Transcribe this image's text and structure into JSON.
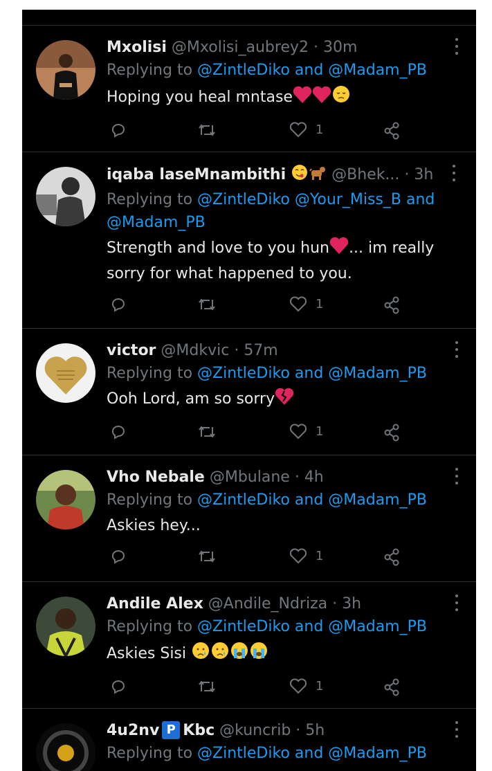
{
  "tweets": [
    {
      "name": "Mxolisi",
      "handle": "@Mxolisi_aubrey2",
      "time": "30m",
      "replying_prefix": "Replying to ",
      "replying_mentions": "@ZintleDiko and @Madam_PB",
      "text": "Hoping you heal mntase",
      "likes": "1"
    },
    {
      "name": "iqaba laseMnambithi",
      "handle": "@Bhek...",
      "time": "3h",
      "replying_prefix": "Replying to ",
      "replying_line1": "@ZintleDiko @Your_Miss_B and",
      "replying_line2": "@Madam_PB",
      "text_a": "Strength and love to you hun",
      "text_b": "... im really sorry for what happened to you.",
      "likes": "1"
    },
    {
      "name": "victor",
      "handle": "@Mdkvic",
      "time": "57m",
      "replying_prefix": "Replying to ",
      "replying_mentions": "@ZintleDiko and @Madam_PB",
      "text": "Ooh Lord, am so sorry",
      "likes": "1"
    },
    {
      "name": "Vho Nebale",
      "handle": "@Mbulane",
      "time": "4h",
      "replying_prefix": "Replying to ",
      "replying_mentions": "@ZintleDiko and @Madam_PB",
      "text": "Askies hey...",
      "likes": "1"
    },
    {
      "name": "Andile Alex",
      "handle": "@Andile_Ndriza",
      "time": "3h",
      "replying_prefix": "Replying to ",
      "replying_mentions": "@ZintleDiko and @Madam_PB",
      "text": "Askies Sisi",
      "likes": "1"
    },
    {
      "name_a": "4u2nv",
      "name_badge": "P",
      "name_b": "Kbc",
      "handle": "@kuncrib",
      "time": "5h",
      "replying_prefix": "Replying to ",
      "replying_mentions": "@ZintleDiko and @Madam_PB"
    }
  ],
  "separator": " · ",
  "colors": {
    "background": "#000000",
    "text": "#e7e9ea",
    "secondary": "#71767b",
    "link": "#1d9bf0",
    "divider": "#2f3336"
  },
  "icons": [
    "reply-icon",
    "retweet-icon",
    "like-icon",
    "share-icon",
    "more-icon"
  ]
}
